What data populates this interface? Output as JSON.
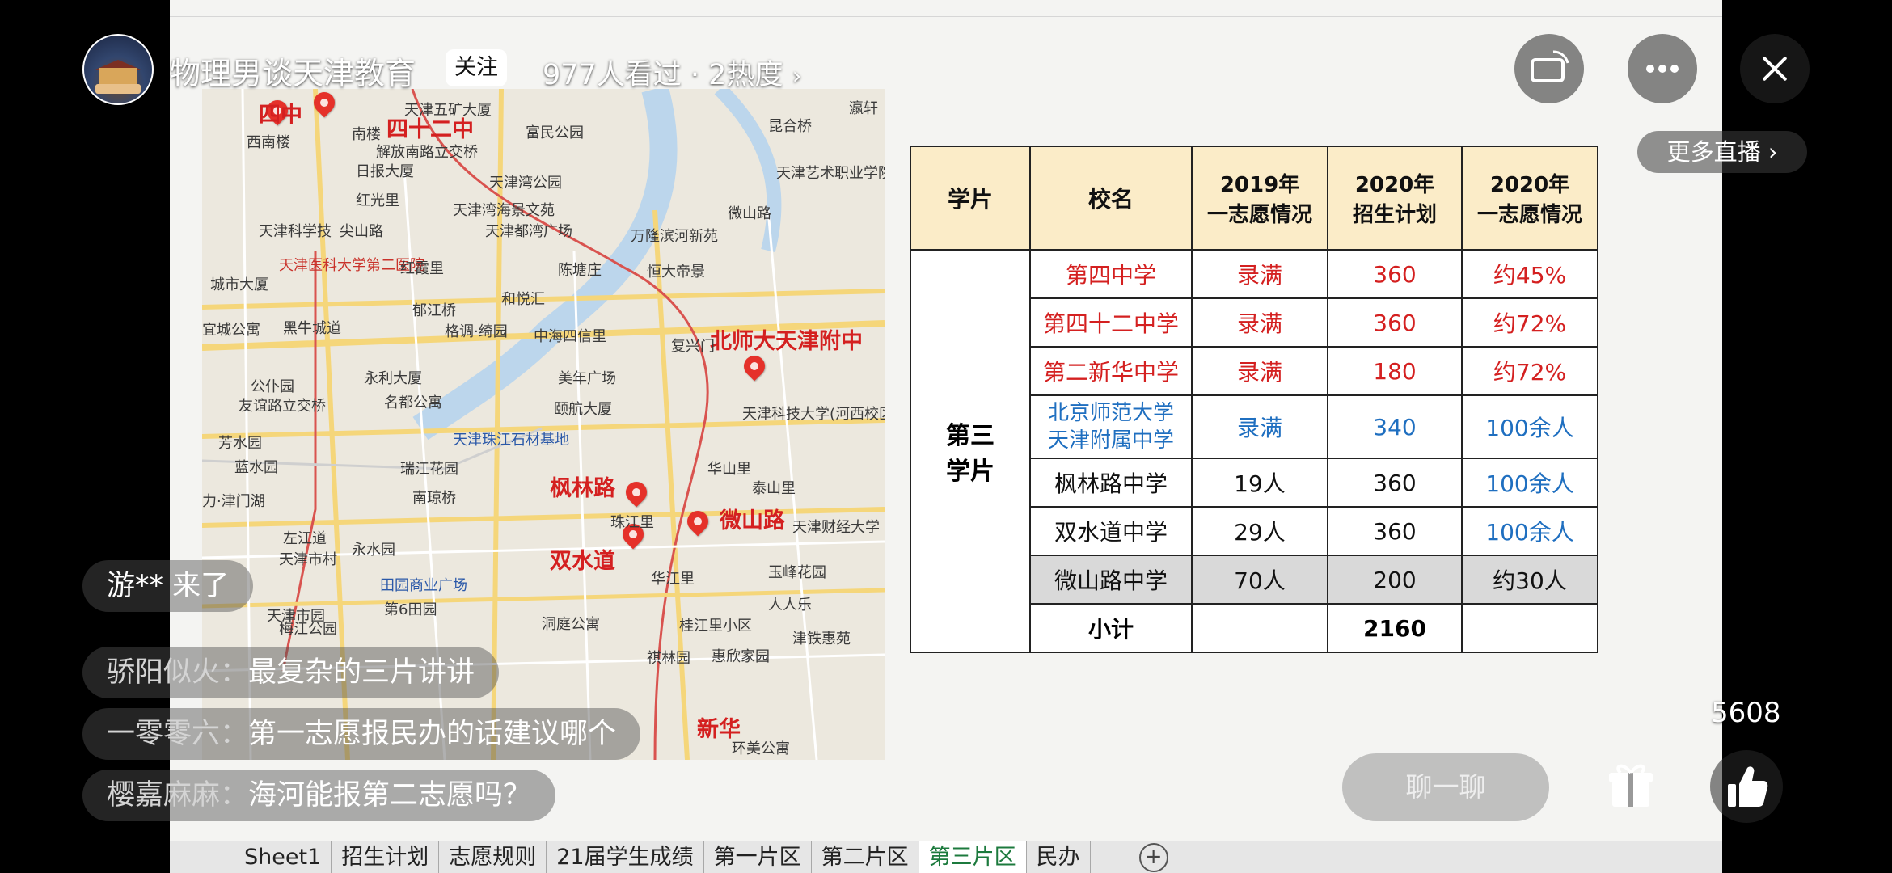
{
  "header": {
    "host_name": "物理男谈天津教育",
    "follow_label": "关注",
    "views_text": "977人看过 · 2热度",
    "more_live_label": "更多直播"
  },
  "map": {
    "school_labels": [
      "四中",
      "四十二中",
      "北师大天津附中",
      "枫林路",
      "微山路",
      "双水道",
      "新华"
    ],
    "place_labels": [
      "西南楼",
      "南楼",
      "天津五矿大厦",
      "富民公园",
      "昆合桥",
      "瀛轩",
      "解放南路立交桥",
      "日报大厦",
      "天津艺术职业学院",
      "天津湾公园",
      "红光里",
      "天津湾海景文苑",
      "尖山路",
      "天津都湾广场",
      "微山路",
      "天津科学技",
      "万隆滨河新苑",
      "天津医科大学第二医院",
      "红霞里",
      "陈塘庄",
      "恒大帝景",
      "城市大厦",
      "郁江桥",
      "和悦汇",
      "格调·绮园",
      "中海四信里",
      "宜城公寓",
      "黑牛城道",
      "复兴门",
      "永利大厦",
      "公仆园",
      "友谊路立交桥",
      "名都公寓",
      "美年广场",
      "颐航大厦",
      "天津科技大学(河西校区)",
      "芳水园",
      "天津珠江石材基地",
      "华山里",
      "蓝水园",
      "瑞江花园",
      "泰山里",
      "力·津门湖",
      "南琼桥",
      "珠江里",
      "天津财经大学",
      "左江道",
      "天津市村",
      "永水园",
      "田园商业广场",
      "第6田园",
      "玉峰花园",
      "华江里",
      "人人乐",
      "天津市园",
      "桂江里小区",
      "洞庭公寓",
      "津铁惠苑",
      "梅江公园",
      "祺林园",
      "惠欣家园",
      "环美公寓"
    ]
  },
  "table": {
    "headers": [
      "学片",
      "校名",
      "2019年一志愿情况",
      "2020年招生计划",
      "2020年一志愿情况"
    ],
    "district": "第三学片",
    "rows": [
      {
        "name": "第四中学",
        "y2019": "录满",
        "plan": "360",
        "y2020": "约45%",
        "color": "#d42020"
      },
      {
        "name": "第四十二中学",
        "y2019": "录满",
        "plan": "360",
        "y2020": "约72%",
        "color": "#d42020"
      },
      {
        "name": "第二新华中学",
        "y2019": "录满",
        "plan": "180",
        "y2020": "约72%",
        "color": "#d42020"
      },
      {
        "name": "北京师范大学天津附属中学",
        "y2019": "录满",
        "plan": "340",
        "y2020": "100余人",
        "color": "#1f6fc0"
      },
      {
        "name": "枫林路中学",
        "y2019": "19人",
        "plan": "360",
        "y2020": "100余人",
        "color": "#111111"
      },
      {
        "name": "双水道中学",
        "y2019": "29人",
        "plan": "360",
        "y2020": "100余人",
        "color": "#111111"
      },
      {
        "name": "微山路中学",
        "y2019": "70人",
        "plan": "200",
        "y2020": "约30人",
        "color": "#111111"
      }
    ],
    "subtotal_label": "小计",
    "subtotal_plan": "2160"
  },
  "sheet_tabs": [
    "Sheet1",
    "招生计划",
    "志愿规则",
    "21届学生成绩",
    "第一片区",
    "第二片区",
    "第三片区",
    "民办"
  ],
  "active_tab": "第三片区",
  "chat": {
    "join_notice": "游** 来了",
    "messages": [
      {
        "user": "骄阳似火：",
        "text": "最复杂的三片讲讲"
      },
      {
        "user": "一零零六：",
        "text": "第一志愿报民办的话建议哪个"
      },
      {
        "user": "樱嘉麻麻：",
        "text": "海河能报第二志愿吗？"
      }
    ],
    "input_placeholder": "聊一聊"
  },
  "likes": {
    "count": "5608"
  },
  "icons": [
    "rotate-screen-icon",
    "more-dots-icon",
    "close-icon",
    "chevron-right-icon",
    "gift-icon",
    "thumbs-up-icon",
    "add-sheet-icon",
    "qr-code"
  ]
}
